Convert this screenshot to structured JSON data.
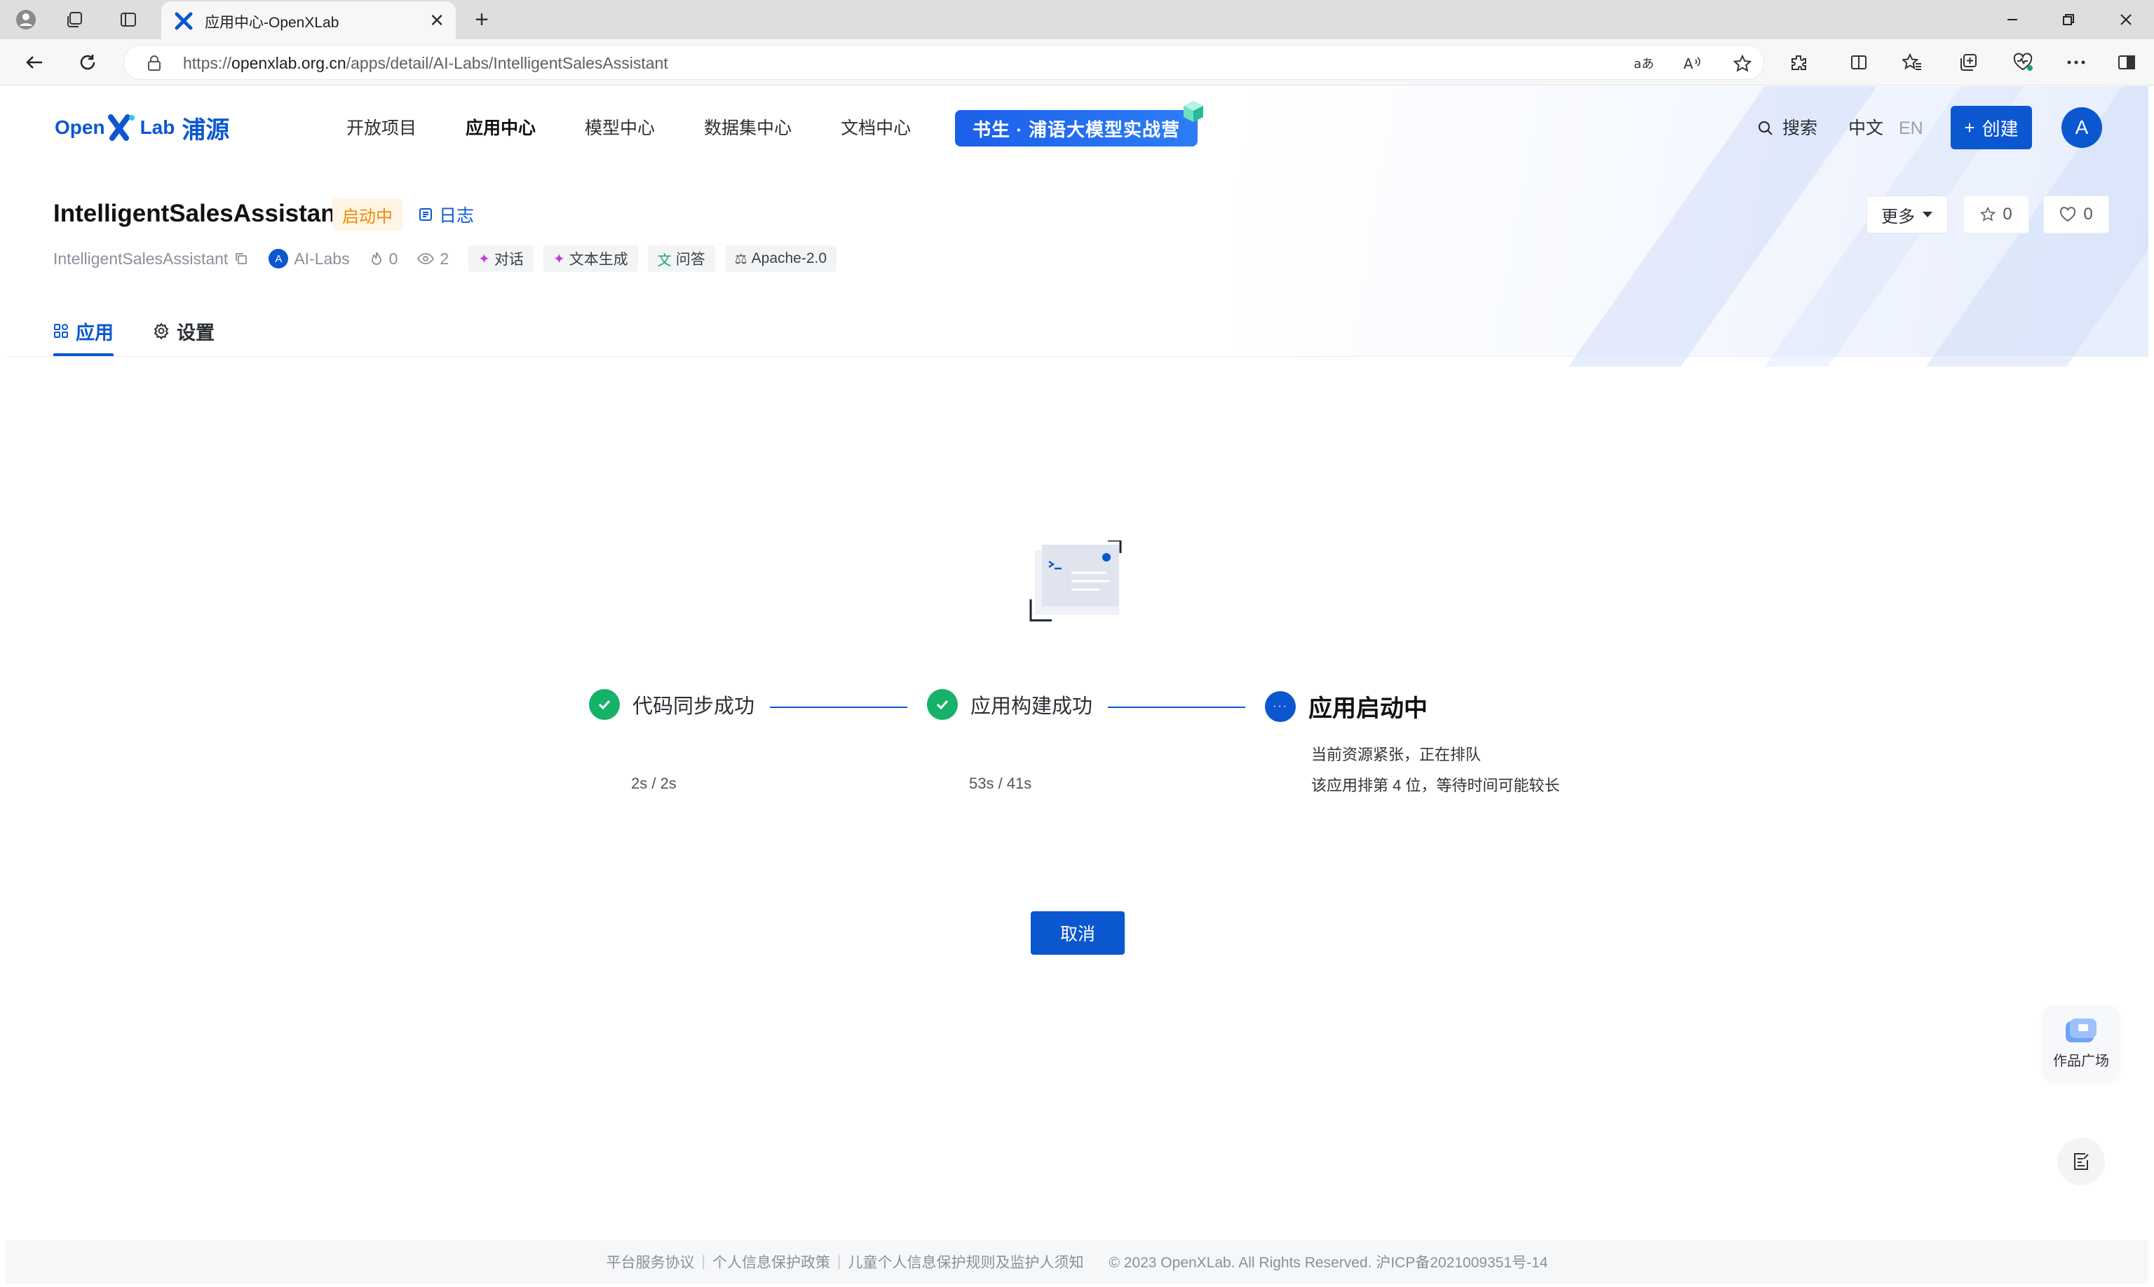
{
  "browser": {
    "tab_title": "应用中心-OpenXLab",
    "url_scheme": "https://",
    "url_host": "openxlab.org.cn",
    "url_path": "/apps/detail/AI-Labs/IntelligentSalesAssistant"
  },
  "header": {
    "logo_open": "Open",
    "logo_lab": "Lab",
    "logo_cn": "浦源",
    "nav": [
      {
        "label": "开放项目",
        "active": false
      },
      {
        "label": "应用中心",
        "active": true
      },
      {
        "label": "模型中心",
        "active": false
      },
      {
        "label": "数据集中心",
        "active": false
      },
      {
        "label": "文档中心",
        "active": false
      }
    ],
    "banner": "书生 · 浦语大模型实战营",
    "search_label": "搜索",
    "lang_zh": "中文",
    "lang_en": "EN",
    "create_label": "创建",
    "avatar_letter": "A"
  },
  "app": {
    "title": "IntelligentSalesAssistant",
    "status": "启动中",
    "log_label": "日志",
    "repo_name": "IntelligentSalesAssistant",
    "owner_initial": "A",
    "owner": "AI-Labs",
    "likes": "0",
    "views": "2",
    "tags": [
      {
        "label": "对话",
        "icon": "sparkle-icon"
      },
      {
        "label": "文本生成",
        "icon": "sparkle-icon"
      },
      {
        "label": "问答",
        "icon": "translate-icon"
      },
      {
        "label": "Apache-2.0",
        "icon": "scale-icon"
      }
    ],
    "more_label": "更多",
    "star_count": "0",
    "heart_count": "0"
  },
  "tabs": [
    {
      "label": "应用",
      "active": true
    },
    {
      "label": "设置",
      "active": false
    }
  ],
  "progress": {
    "steps": [
      {
        "label": "代码同步成功",
        "time": "2s / 2s",
        "state": "done"
      },
      {
        "label": "应用构建成功",
        "time": "53s / 41s",
        "state": "done"
      },
      {
        "label": "应用启动中",
        "state": "running"
      }
    ],
    "queue_message_1": "当前资源紧张，正在排队",
    "queue_message_2": "该应用排第 4 位，等待时间可能较长",
    "cancel_label": "取消"
  },
  "floating": {
    "gallery_label": "作品广场"
  },
  "footer": {
    "links": [
      "平台服务协议",
      "个人信息保护政策",
      "儿童个人信息保护规则及监护人须知"
    ],
    "copyright": "© 2023 OpenXLab. All Rights Reserved. 沪ICP备2021009351号-14"
  },
  "colors": {
    "primary": "#0b57d0",
    "success": "#17b26a",
    "warning": "#f08a00"
  }
}
